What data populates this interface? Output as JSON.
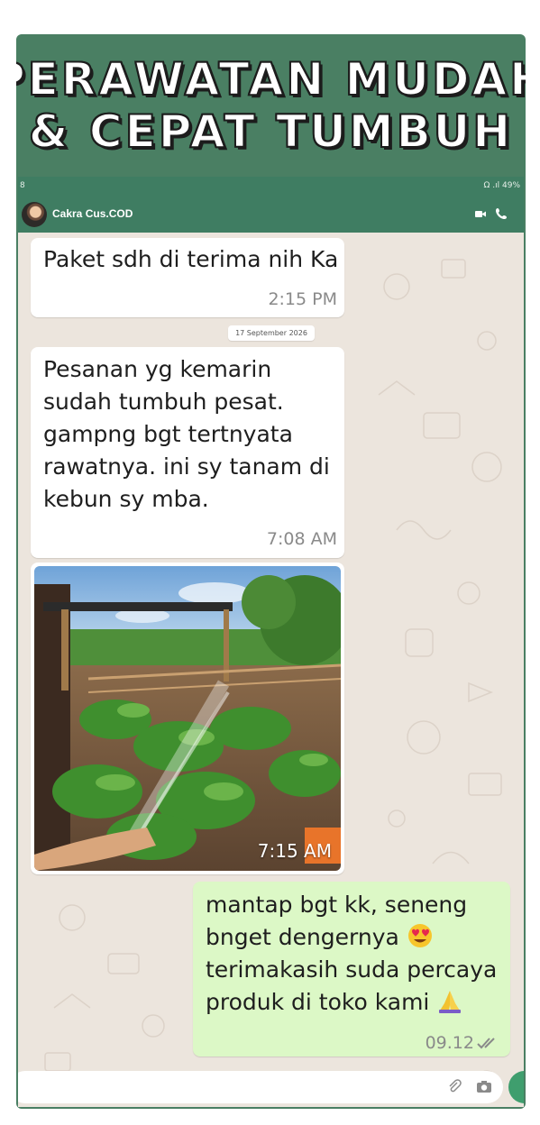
{
  "banner": {
    "line1": "PERAWATAN MUDAH",
    "line2": "& CEPAT TUMBUH"
  },
  "status_bar": {
    "time": "8",
    "right": "Ω .ıl 49%"
  },
  "header": {
    "contact_name": "Cakra Cus.COD"
  },
  "messages": [
    {
      "direction": "incoming",
      "text": "Paket sdh di terima nih Ka",
      "time": "2:15 PM"
    },
    {
      "direction": "incoming",
      "text": "Pesanan yg kemarin sudah tumbuh pesat. gampng bgt tertnyata rawatnya. ini sy tanam di kebun sy mba.",
      "time": "7:08 AM"
    },
    {
      "direction": "incoming",
      "type": "image",
      "time": "7:15 AM"
    },
    {
      "direction": "outgoing",
      "text_before_emoji": "mantap bgt kk, seneng bnget dengernya",
      "text_after_emoji": "terimakasih suda percaya produk di toko kami",
      "emoji_1": "heart-eyes-emoji",
      "emoji_2": "folded-hands-emoji",
      "time": "09.12",
      "read_status": "double-check-icon"
    }
  ],
  "date_chip": "17 September 2026",
  "colors": {
    "header_green": "#3f7d62",
    "banner_green": "#4a7f63",
    "chat_bg": "#ece5dd",
    "outgoing_bubble": "#dcf8c6",
    "incoming_bubble": "#ffffff"
  }
}
